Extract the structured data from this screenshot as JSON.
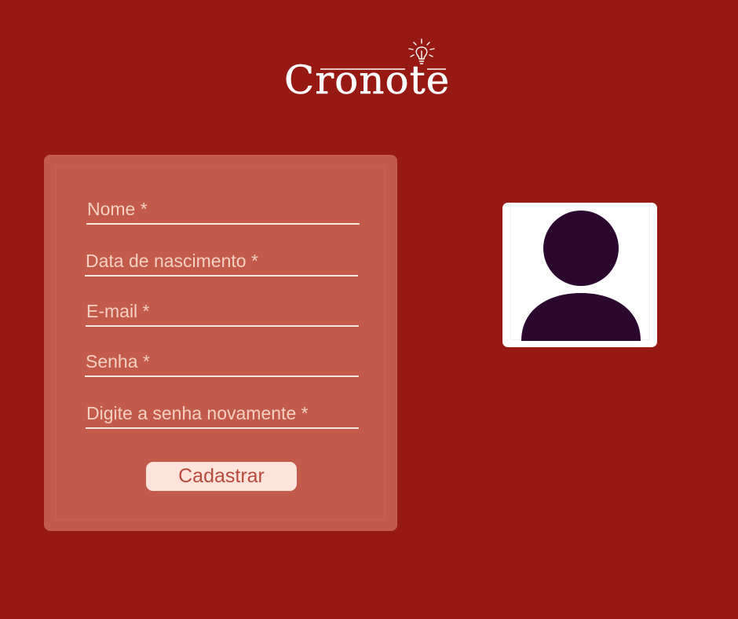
{
  "brand": {
    "name": "Cronote"
  },
  "form": {
    "fields": [
      {
        "placeholder": "Nome *"
      },
      {
        "placeholder": "Data de nascimento *"
      },
      {
        "placeholder": "E-mail *"
      },
      {
        "placeholder": "Senha *"
      },
      {
        "placeholder": "Digite a senha novamente *"
      }
    ],
    "submit_label": "Cadastrar"
  },
  "avatar": {
    "icon": "user-silhouette-icon"
  },
  "colors": {
    "background": "#971913",
    "card": "#c25b4c",
    "button": "#fde3da",
    "button_text": "#b84a3c",
    "avatar_fill": "#2c0830"
  }
}
